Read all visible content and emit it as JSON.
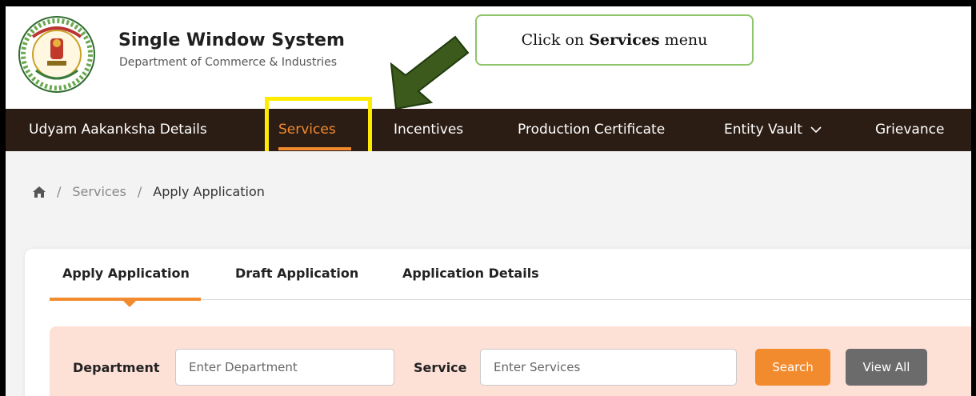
{
  "brand": {
    "title": "Single Window System",
    "subtitle": "Department of Commerce & Industries"
  },
  "callout": {
    "prefix": "Click on ",
    "bold": "Services",
    "suffix": " menu"
  },
  "nav": {
    "items": [
      {
        "label": "Udyam Aakanksha Details"
      },
      {
        "label": "Services"
      },
      {
        "label": "Incentives"
      },
      {
        "label": "Production Certificate"
      },
      {
        "label": "Entity Vault"
      },
      {
        "label": "Grievance"
      }
    ],
    "active": "Services"
  },
  "breadcrumb": {
    "home_icon": "home-icon",
    "items": [
      "Services",
      "Apply Application"
    ],
    "separator": "/"
  },
  "tabs": {
    "items": [
      {
        "label": "Apply Application"
      },
      {
        "label": "Draft Application"
      },
      {
        "label": "Application Details"
      }
    ],
    "active": "Apply Application"
  },
  "filter": {
    "department_label": "Department",
    "department_placeholder": "Enter Department",
    "service_label": "Service",
    "service_placeholder": "Enter Services",
    "search_label": "Search",
    "view_all_label": "View All"
  },
  "colors": {
    "nav_bg": "#2b1d14",
    "accent": "#f28a2e",
    "highlight": "#ffeb00",
    "arrow": "#3b5a1c",
    "callout_border": "#8dc56a",
    "filter_bg": "#fde0d6"
  }
}
